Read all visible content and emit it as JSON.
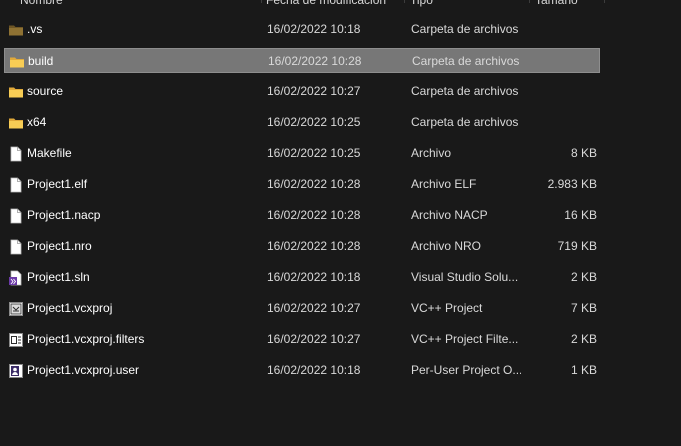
{
  "header": {
    "name": "Nombre",
    "date": "Fecha de modificación",
    "type": "Tipo",
    "size": "Tamaño"
  },
  "files": [
    {
      "name": ".vs",
      "date": "16/02/2022 10:18",
      "type": "Carpeta de archivos",
      "size": "",
      "icon": "folder-dark-icon"
    },
    {
      "name": "build",
      "date": "16/02/2022 10:28",
      "type": "Carpeta de archivos",
      "size": "",
      "icon": "folder-icon"
    },
    {
      "name": "source",
      "date": "16/02/2022 10:27",
      "type": "Carpeta de archivos",
      "size": "",
      "icon": "folder-icon"
    },
    {
      "name": "x64",
      "date": "16/02/2022 10:25",
      "type": "Carpeta de archivos",
      "size": "",
      "icon": "folder-icon"
    },
    {
      "name": "Makefile",
      "date": "16/02/2022 10:25",
      "type": "Archivo",
      "size": "8 KB",
      "icon": "file-icon"
    },
    {
      "name": "Project1.elf",
      "date": "16/02/2022 10:28",
      "type": "Archivo ELF",
      "size": "2.983 KB",
      "icon": "file-icon"
    },
    {
      "name": "Project1.nacp",
      "date": "16/02/2022 10:28",
      "type": "Archivo NACP",
      "size": "16 KB",
      "icon": "file-icon"
    },
    {
      "name": "Project1.nro",
      "date": "16/02/2022 10:28",
      "type": "Archivo NRO",
      "size": "719 KB",
      "icon": "file-icon"
    },
    {
      "name": "Project1.sln",
      "date": "16/02/2022 10:18",
      "type": "Visual Studio Solu...",
      "size": "2 KB",
      "icon": "visual-studio-solution-icon"
    },
    {
      "name": "Project1.vcxproj",
      "date": "16/02/2022 10:27",
      "type": "VC++ Project",
      "size": "7 KB",
      "icon": "vcxproj-icon"
    },
    {
      "name": "Project1.vcxproj.filters",
      "date": "16/02/2022 10:27",
      "type": "VC++ Project Filte...",
      "size": "2 KB",
      "icon": "vcxproj-filters-icon"
    },
    {
      "name": "Project1.vcxproj.user",
      "date": "16/02/2022 10:18",
      "type": "Per-User Project O...",
      "size": "1 KB",
      "icon": "vcxproj-user-icon"
    }
  ],
  "selected_index": 1,
  "colors": {
    "background": "#191919",
    "selection": "#777777",
    "folder": "#f5c543",
    "folder_dark": "#8a6d2a"
  }
}
